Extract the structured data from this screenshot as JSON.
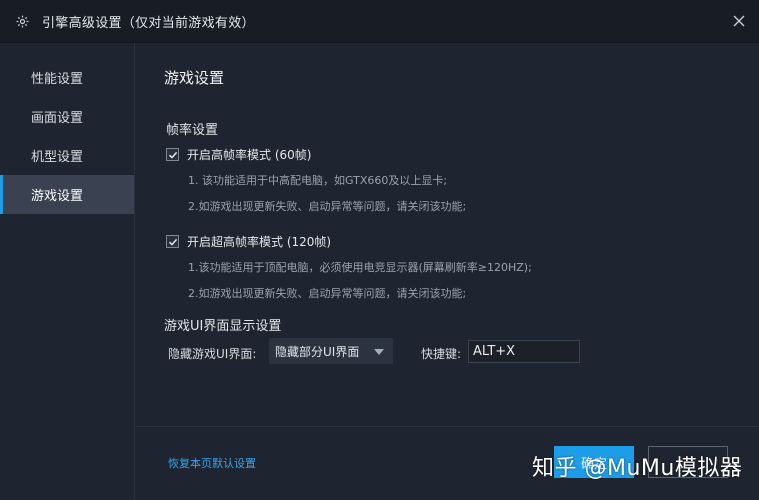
{
  "window": {
    "title": "引擎高级设置（仅对当前游戏有效）"
  },
  "sidebar": {
    "items": [
      {
        "label": "性能设置"
      },
      {
        "label": "画面设置"
      },
      {
        "label": "机型设置"
      },
      {
        "label": "游戏设置"
      }
    ],
    "active_index": 3
  },
  "main": {
    "section_title": "游戏设置",
    "frame_rate": {
      "title": "帧率设置",
      "option1": {
        "label": "开启高帧率模式 (60帧)",
        "checked": true,
        "note1": "1. 该功能适用于中高配电脑，如GTX660及以上显卡;",
        "note2": "2.如游戏出现更新失败、启动异常等问题，请关闭该功能;"
      },
      "option2": {
        "label": "开启超高帧率模式 (120帧)",
        "checked": true,
        "note1": "1.该功能适用于顶配电脑，必须使用电竞显示器(屏幕刷新率≥120HZ);",
        "note2": "2.如游戏出现更新失败、启动异常等问题，请关闭该功能;"
      }
    },
    "ui_display": {
      "title": "游戏UI界面显示设置",
      "hide_label": "隐藏游戏UI界面:",
      "hide_value": "隐藏部分UI界面",
      "hotkey_label": "快捷键:",
      "hotkey_value": "ALT+X"
    }
  },
  "footer": {
    "reset_label": "恢复本页默认设置",
    "confirm_label": "确定",
    "cancel_label": ""
  },
  "watermark": "知乎 @MuMu模拟器",
  "colors": {
    "accent": "#1d9ce8",
    "background": "#1f2530",
    "titlebar": "#171c25",
    "active_item": "#3a4252",
    "link": "#3aa4ee"
  }
}
